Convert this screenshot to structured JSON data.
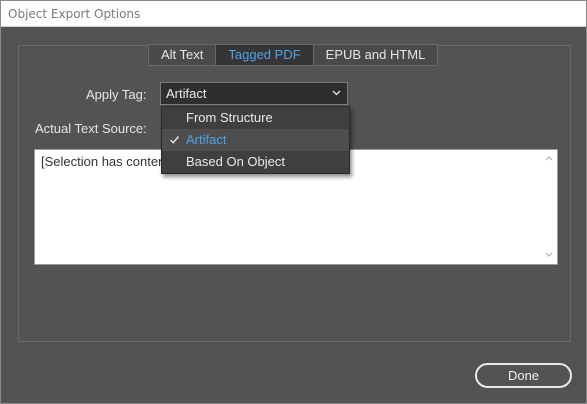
{
  "window": {
    "title": "Object Export Options"
  },
  "tabs": [
    {
      "label": "Alt Text",
      "active": false
    },
    {
      "label": "Tagged PDF",
      "active": true
    },
    {
      "label": "EPUB and HTML",
      "active": false
    }
  ],
  "apply_tag": {
    "label": "Apply Tag:",
    "selected": "Artifact",
    "options": [
      {
        "label": "From Structure",
        "checked": false
      },
      {
        "label": "Artifact",
        "checked": true
      },
      {
        "label": "Based On Object",
        "checked": false
      }
    ]
  },
  "actual_text": {
    "label": "Actual Text Source:",
    "content": "[Selection has conten"
  },
  "buttons": {
    "done": "Done"
  },
  "colors": {
    "dialog_bg": "#535353",
    "accent": "#4fa1ea",
    "active_tab_bg": "#353535"
  }
}
